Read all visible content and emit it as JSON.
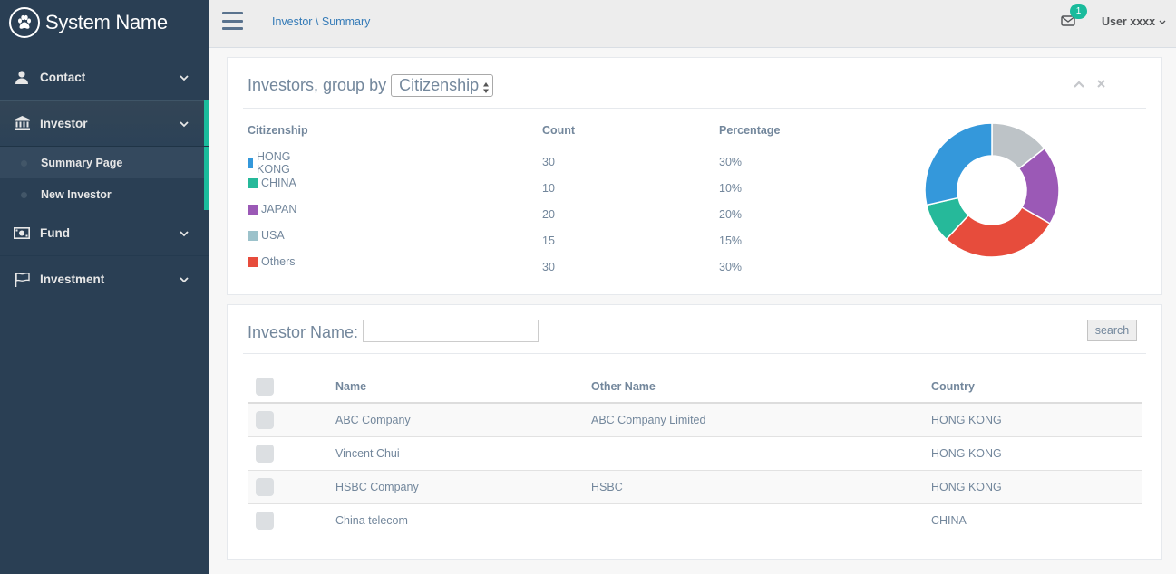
{
  "brand": {
    "name": "System Name",
    "logo_icon": "paw-icon"
  },
  "sidebar": {
    "items": [
      {
        "label": "Contact",
        "icon": "user-icon"
      },
      {
        "label": "Investor",
        "icon": "bank-icon",
        "active": true,
        "children": [
          {
            "label": "Summary Page",
            "current": true
          },
          {
            "label": "New Investor"
          }
        ]
      },
      {
        "label": "Fund",
        "icon": "money-icon"
      },
      {
        "label": "Investment",
        "icon": "flag-icon"
      }
    ]
  },
  "topnav": {
    "breadcrumb": "Investor \\ Summary",
    "mail_count": "1",
    "user": "User xxxx"
  },
  "summary": {
    "title": "Investors, group by",
    "group_by": "Citizenship",
    "headers": {
      "category": "Citizenship",
      "count": "Count",
      "percentage": "Percentage"
    },
    "rows": [
      {
        "name": "HONG KONG",
        "count": "30",
        "percentage": "30%",
        "color": "#3498db"
      },
      {
        "name": "CHINA",
        "count": "10",
        "percentage": "10%",
        "color": "#26b99a"
      },
      {
        "name": "JAPAN",
        "count": "20",
        "percentage": "20%",
        "color": "#9b59b6"
      },
      {
        "name": "USA",
        "count": "15",
        "percentage": "15%",
        "color": "#9cc2cb"
      },
      {
        "name": "Others",
        "count": "30",
        "percentage": "30%",
        "color": "#e74c3c"
      }
    ]
  },
  "chart_data": {
    "type": "pie",
    "donut": true,
    "categories": [
      "USA",
      "JAPAN",
      "Others",
      "CHINA",
      "HONG KONG"
    ],
    "values": [
      15,
      20,
      30,
      10,
      30
    ],
    "colors": [
      "#bdc3c7",
      "#9b59b6",
      "#e74c3c",
      "#26b99a",
      "#3498db"
    ]
  },
  "search": {
    "label": "Investor Name:",
    "value": "",
    "placeholder": "",
    "button": "search"
  },
  "investors": {
    "headers": {
      "name": "Name",
      "other_name": "Other Name",
      "country": "Country"
    },
    "rows": [
      {
        "name": "ABC Company",
        "other_name": "ABC Company Limited",
        "country": "HONG KONG"
      },
      {
        "name": "Vincent Chui",
        "other_name": "",
        "country": "HONG KONG"
      },
      {
        "name": "HSBC Company",
        "other_name": "HSBC",
        "country": "HONG KONG"
      },
      {
        "name": "China telecom",
        "other_name": "",
        "country": "CHINA"
      }
    ]
  }
}
